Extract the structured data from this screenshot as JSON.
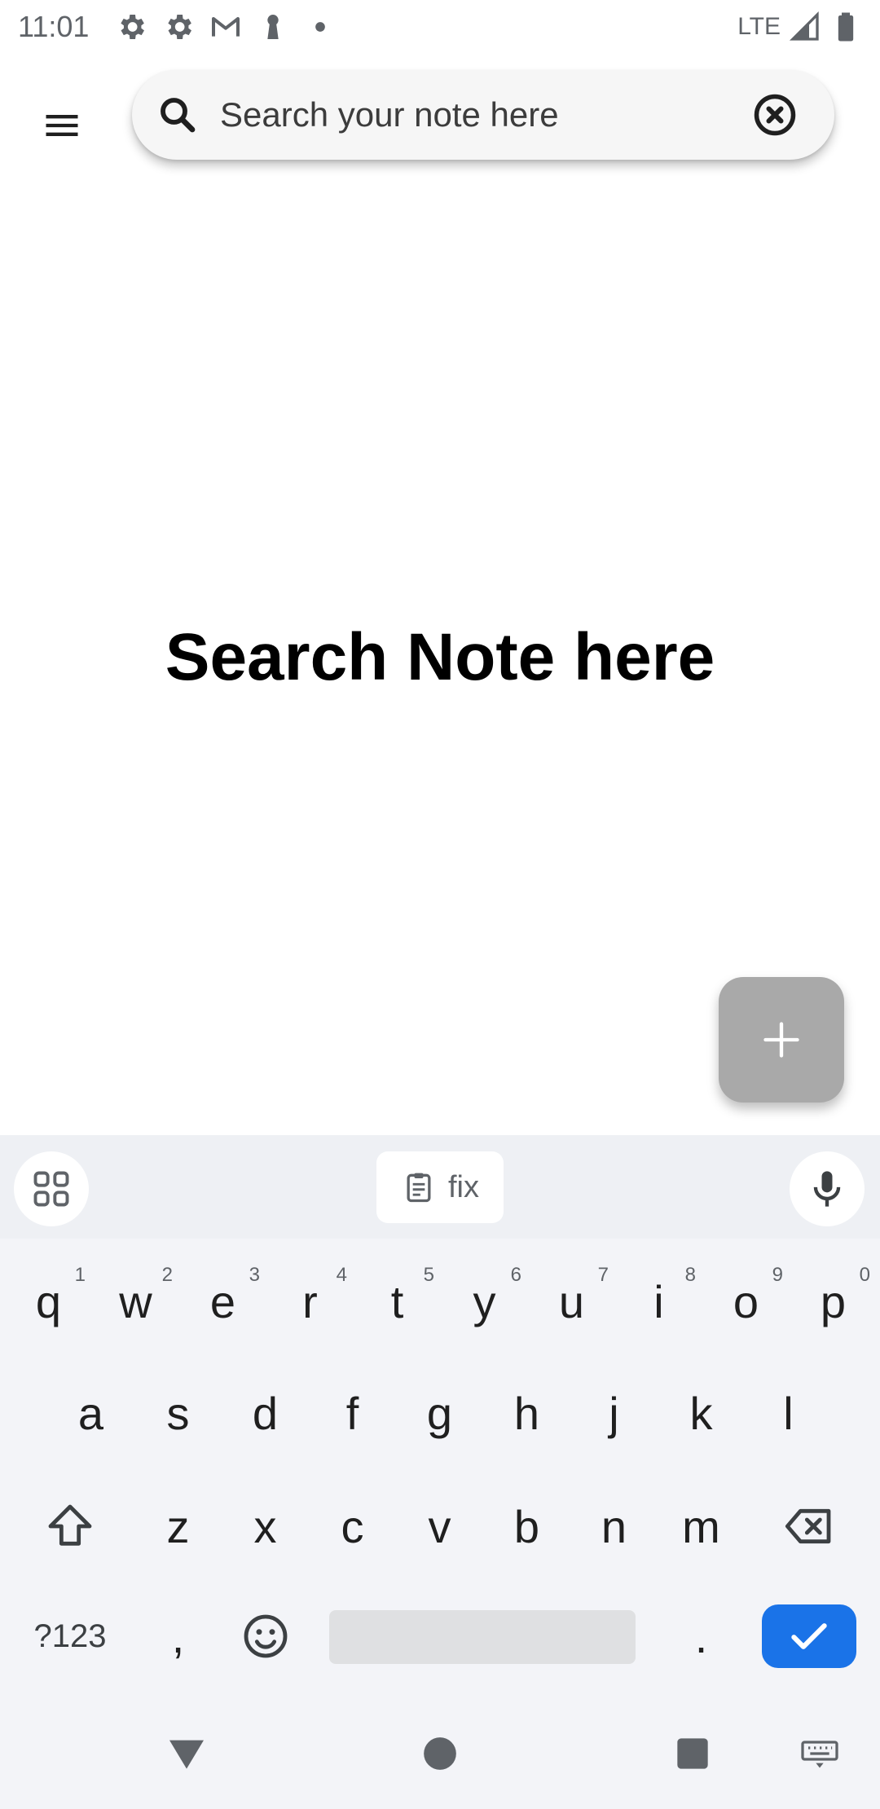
{
  "status_bar": {
    "time": "11:01",
    "network": "LTE",
    "icons": [
      "settings-icon",
      "settings-icon",
      "gmail-icon",
      "keyhole-icon",
      "dot-icon",
      "signal-icon",
      "battery-icon"
    ]
  },
  "top_bar": {
    "menu_icon": "menu-icon",
    "search": {
      "placeholder": "Search your note here",
      "value": "",
      "icon": "search-icon",
      "clear_icon": "clear-circle-icon"
    }
  },
  "main": {
    "empty_title": "Search Note here"
  },
  "fab": {
    "icon": "plus-icon",
    "color": "#a9a9a9"
  },
  "keyboard": {
    "toolbar": {
      "apps_icon": "grid-icon",
      "clipboard_label": "fix",
      "mic_icon": "mic-icon"
    },
    "row1": [
      {
        "key": "q",
        "hint": "1"
      },
      {
        "key": "w",
        "hint": "2"
      },
      {
        "key": "e",
        "hint": "3"
      },
      {
        "key": "r",
        "hint": "4"
      },
      {
        "key": "t",
        "hint": "5"
      },
      {
        "key": "y",
        "hint": "6"
      },
      {
        "key": "u",
        "hint": "7"
      },
      {
        "key": "i",
        "hint": "8"
      },
      {
        "key": "o",
        "hint": "9"
      },
      {
        "key": "p",
        "hint": "0"
      }
    ],
    "row2": [
      "a",
      "s",
      "d",
      "f",
      "g",
      "h",
      "j",
      "k",
      "l"
    ],
    "row3": [
      "z",
      "x",
      "c",
      "v",
      "b",
      "n",
      "m"
    ],
    "row4": {
      "symbols_label": "?123",
      "comma": ",",
      "period": "."
    },
    "accent_color": "#1a73e8"
  },
  "nav_bar": {
    "icons": [
      "back-icon",
      "home-icon",
      "recents-icon",
      "keyboard-switch-icon"
    ]
  }
}
